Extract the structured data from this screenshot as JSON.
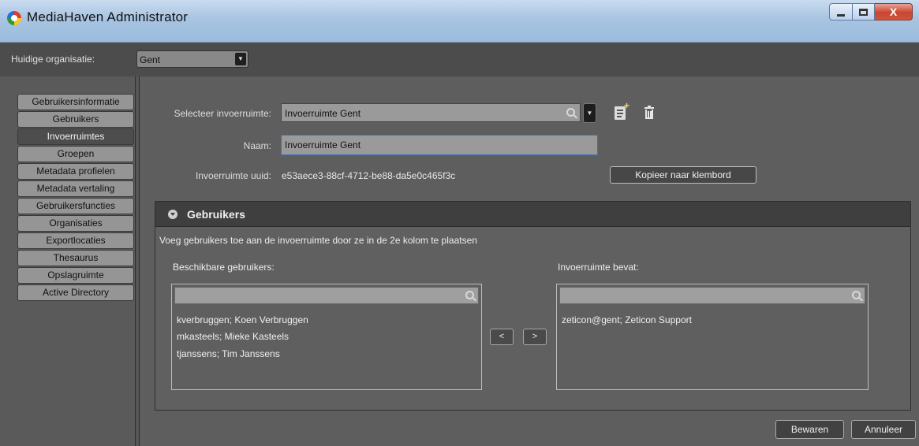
{
  "window": {
    "title": "MediaHaven Administrator",
    "close_glyph": "X"
  },
  "org": {
    "label": "Huidige organisatie:",
    "selected": "Gent",
    "dropdown_glyph": "▼"
  },
  "sidebar": {
    "items": [
      {
        "label": "Gebruikersinformatie",
        "active": false
      },
      {
        "label": "Gebruikers",
        "active": false
      },
      {
        "label": "Invoerruimtes",
        "active": true
      },
      {
        "label": "Groepen",
        "active": false
      },
      {
        "label": "Metadata profielen",
        "active": false
      },
      {
        "label": "Metadata vertaling",
        "active": false
      },
      {
        "label": "Gebruikersfuncties",
        "active": false
      },
      {
        "label": "Organisaties",
        "active": false
      },
      {
        "label": "Exportlocaties",
        "active": false
      },
      {
        "label": "Thesaurus",
        "active": false
      },
      {
        "label": "Opslagruimte",
        "active": false
      },
      {
        "label": "Active Directory",
        "active": false
      }
    ]
  },
  "form": {
    "select_label": "Selecteer invoerruimte:",
    "select_value": "Invoerruimte Gent",
    "dropdown_glyph": "▼",
    "name_label": "Naam:",
    "name_value": "Invoerruimte Gent",
    "uuid_label": "Invoerruimte uuid:",
    "uuid_value": "e53aece3-88cf-4712-be88-da5e0c465f3c",
    "copy_button": "Kopieer naar klembord"
  },
  "users_panel": {
    "title": "Gebruikers",
    "hint": "Voeg gebruikers toe aan de invoerruimte door ze in de 2e kolom te plaatsen",
    "available_label": "Beschikbare gebruikers:",
    "available": [
      "kverbruggen; Koen Verbruggen",
      "mkasteels; Mieke Kasteels",
      "tjanssens; Tim Janssens"
    ],
    "contains_label": "Invoerruimte bevat:",
    "contains": [
      "zeticon@gent; Zeticon Support"
    ],
    "move_left": "<",
    "move_right": ">"
  },
  "footer": {
    "save": "Bewaren",
    "cancel": "Annuleer"
  },
  "colors": {
    "background": "#5e5e5e",
    "titlebar": "#a8c4e2",
    "active_nav": "#4d4d4d",
    "nav_item": "#959595"
  }
}
